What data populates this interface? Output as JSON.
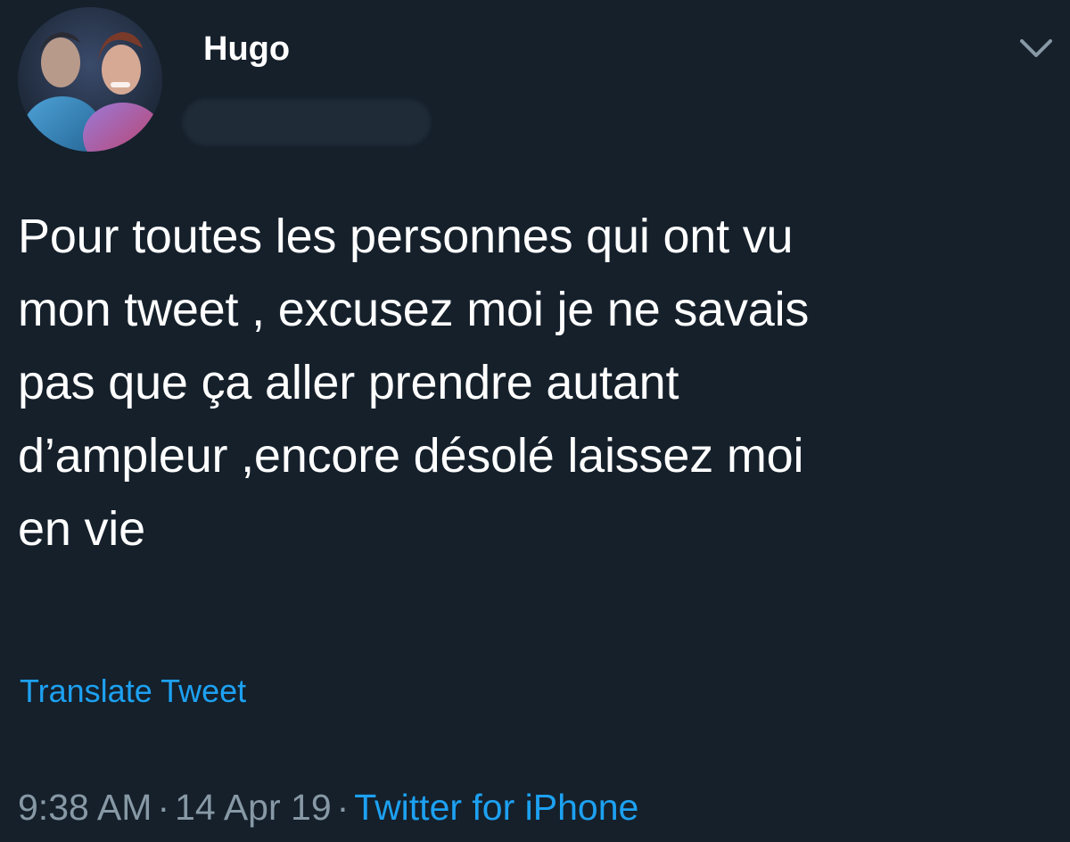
{
  "tweet": {
    "author": {
      "display_name": "Hugo",
      "avatar_icon": "profile-photo"
    },
    "text": "Pour toutes les personnes qui ont vu\nmon tweet , excusez moi je ne savais\npas que ça aller prendre autant\nd’ampleur ,encore désolé laissez moi\nen vie",
    "translate_label": "Translate Tweet",
    "time": "9:38 AM",
    "separator": "·",
    "date": "14 Apr 19",
    "source": "Twitter for iPhone",
    "menu_icon": "chevron-down-icon"
  },
  "colors": {
    "background": "#15202b",
    "text": "#ffffff",
    "secondary_text": "#8899a6",
    "link": "#1da1f2"
  }
}
